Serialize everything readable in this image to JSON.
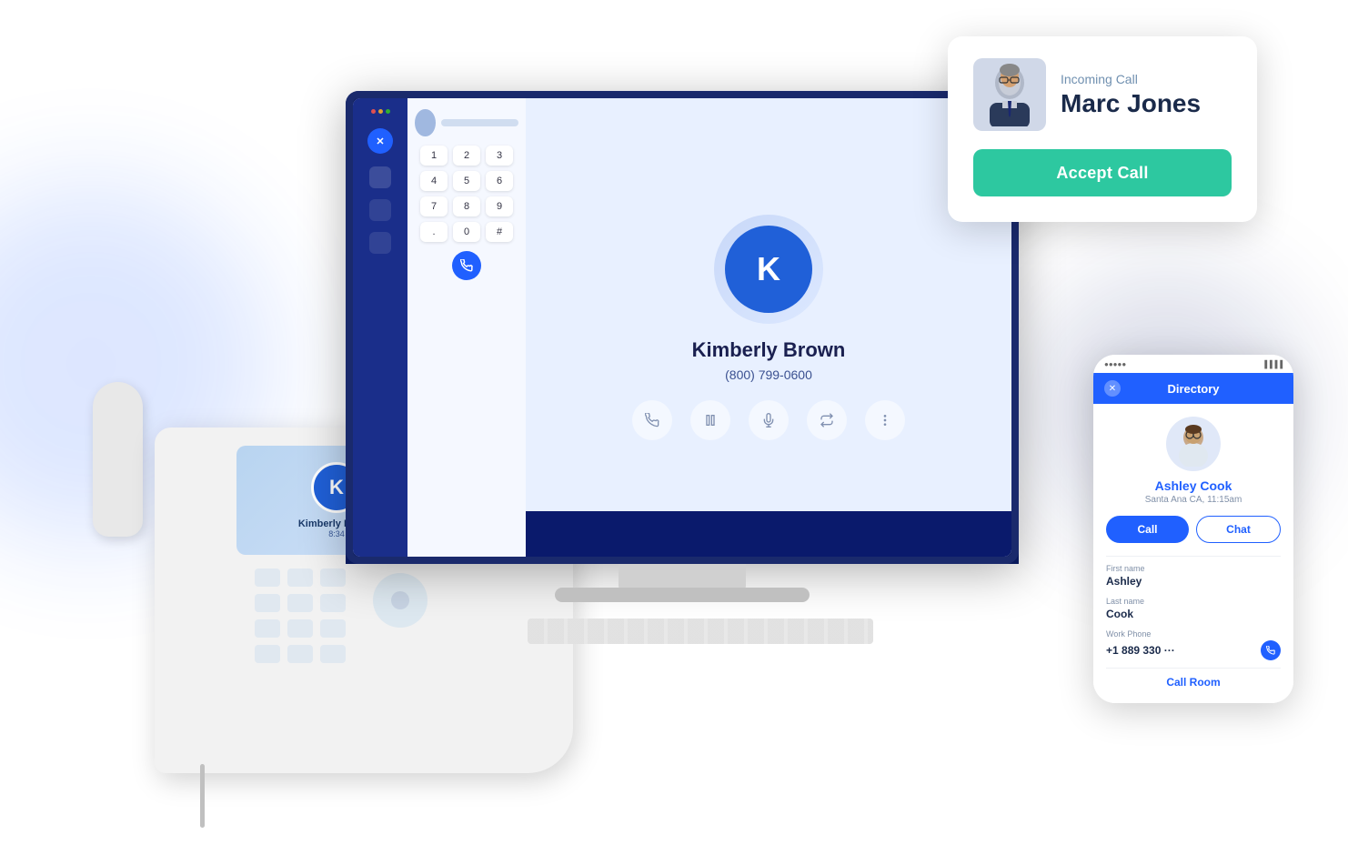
{
  "scene": {
    "bg": "#ffffff"
  },
  "incoming_call": {
    "label": "Incoming Call",
    "caller_name": "Marc Jones",
    "accept_button": "Accept Call"
  },
  "app": {
    "keypad": {
      "keys": [
        "1",
        "2",
        "3",
        "4",
        "5",
        "6",
        "7",
        "8",
        "9",
        ".",
        "0",
        "#"
      ]
    },
    "contact": {
      "name": "Kimberly Brown",
      "phone": "(800) 799-0600"
    }
  },
  "deskphone": {
    "contact_name": "Kimberly Brown",
    "time": "8:34"
  },
  "directory": {
    "title": "Directory",
    "contact": {
      "first_name": "Ashley",
      "last_name": "Cook",
      "display_name": "Ashley Cook",
      "location": "Santa Ana CA, 11:15am",
      "work_phone_label": "Work Phone",
      "work_phone": "+1 889 330 ···",
      "call_btn": "Call",
      "chat_btn": "Chat",
      "first_name_label": "First name",
      "last_name_label": "Last name",
      "call_room_link": "Call Room"
    }
  }
}
